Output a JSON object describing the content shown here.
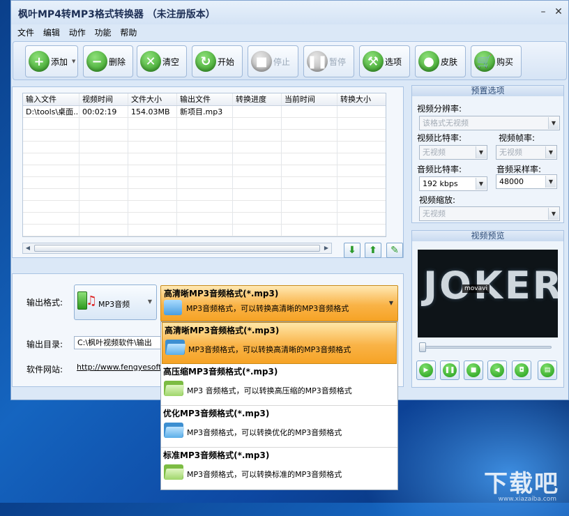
{
  "window": {
    "title": "枫叶MP4转MP3格式转换器  （未注册版本）"
  },
  "menu": [
    "文件",
    "编辑",
    "动作",
    "功能",
    "帮助"
  ],
  "toolbar": [
    {
      "label": "添加",
      "icon": "plus-icon",
      "has_dropdown": true,
      "enabled": true
    },
    {
      "label": "删除",
      "icon": "minus-icon",
      "enabled": true
    },
    {
      "label": "清空",
      "icon": "clear-x-icon",
      "enabled": true
    },
    {
      "label": "开始",
      "icon": "refresh-icon",
      "enabled": true
    },
    {
      "label": "停止",
      "icon": "stop-icon",
      "enabled": false
    },
    {
      "label": "暂停",
      "icon": "pause-icon",
      "enabled": false
    },
    {
      "label": "选项",
      "icon": "tools-icon",
      "enabled": true
    },
    {
      "label": "皮肤",
      "icon": "apple-icon",
      "enabled": true
    },
    {
      "label": "购买",
      "icon": "cart-icon",
      "enabled": true
    }
  ],
  "file_table": {
    "columns": [
      "输入文件",
      "视频时间",
      "文件大小",
      "输出文件",
      "转换进度",
      "当前时间",
      "转换大小"
    ],
    "rows": [
      [
        "D:\\tools\\桌面...",
        "00:02:19",
        "154.03MB",
        "新项目.mp3",
        "",
        "",
        ""
      ]
    ]
  },
  "output": {
    "format_label": "输出格式:",
    "format_value": "MP3音频",
    "dir_label": "输出目录:",
    "dir_value": "C:\\枫叶视频软件\\输出",
    "site_label": "软件网站:",
    "site_value": "http://www.fengyesoft.c"
  },
  "quality": {
    "selected_title": "高清晰MP3音频格式(*.mp3)",
    "selected_desc": "MP3音频格式，可以转换高清晰的MP3音频格式",
    "options": [
      {
        "title": "高清晰MP3音频格式(*.mp3)",
        "desc": "MP3音频格式，可以转换高清晰的MP3音频格式",
        "folder_color": "#5aaee8",
        "selected": true
      },
      {
        "title": "高压缩MP3音频格式(*.mp3)",
        "desc": "MP3 音频格式，可以转换高压缩的MP3音频格式",
        "folder_color": "#9fd66a",
        "selected": false
      },
      {
        "title": "优化MP3音频格式(*.mp3)",
        "desc": "MP3音频格式，可以转换优化的MP3音频格式",
        "folder_color": "#5aaee8",
        "selected": false
      },
      {
        "title": "标准MP3音频格式(*.mp3)",
        "desc": "MP3音频格式，可以转换标准的MP3音频格式",
        "folder_color": "#9fd66a",
        "selected": false
      }
    ]
  },
  "presets": {
    "title": "预置选项",
    "video_resolution_label": "视频分辨率:",
    "video_resolution_value": "该格式无视频",
    "video_bitrate_label": "视频比特率:",
    "video_bitrate_value": "无视频",
    "video_framerate_label": "视频帧率:",
    "video_framerate_value": "无视频",
    "audio_bitrate_label": "音频比特率:",
    "audio_bitrate_value": "192 kbps",
    "audio_samplerate_label": "音频采样率:",
    "audio_samplerate_value": "48000",
    "video_scale_label": "视频缩放:",
    "video_scale_value": "无视频"
  },
  "preview": {
    "title": "视频预览",
    "frame_text": "JOKER",
    "watermark_text": "movavi",
    "seek_position": 0
  },
  "desktop": {
    "watermark": "下载吧",
    "watermark_sub": "www.xiazaiba.com"
  }
}
